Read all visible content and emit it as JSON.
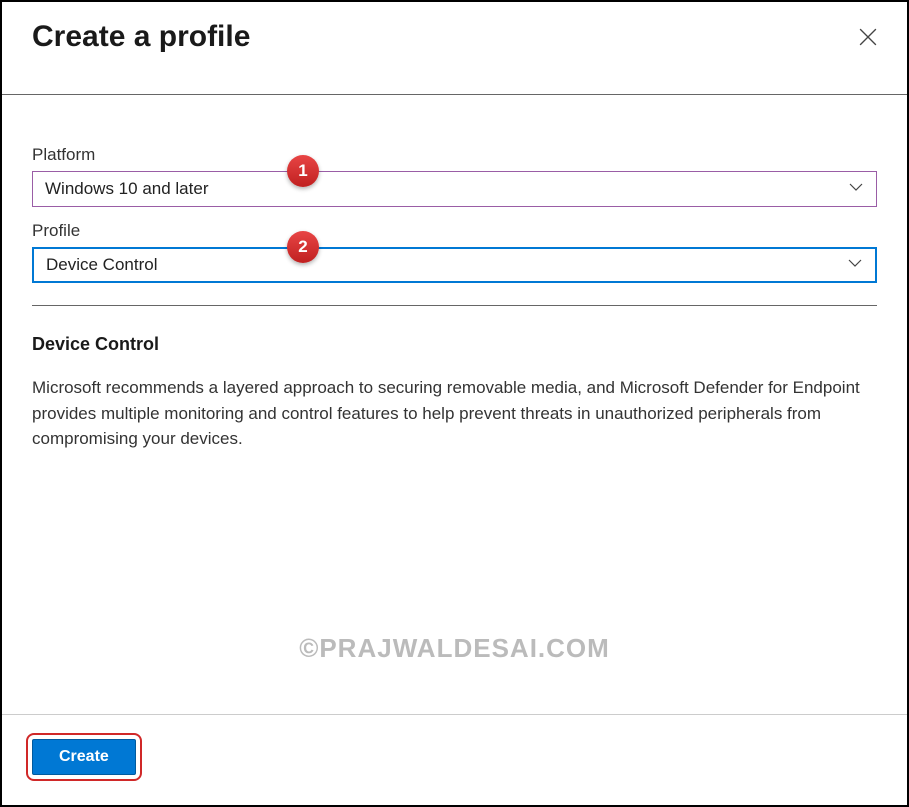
{
  "header": {
    "title": "Create a profile"
  },
  "fields": {
    "platform": {
      "label": "Platform",
      "value": "Windows 10 and later",
      "badge": "1"
    },
    "profile": {
      "label": "Profile",
      "value": "Device Control",
      "badge": "2"
    }
  },
  "section": {
    "title": "Device Control",
    "description": "Microsoft recommends a layered approach to securing removable media, and Microsoft Defender for Endpoint provides multiple monitoring and control features to help prevent threats in unauthorized peripherals from compromising your devices."
  },
  "watermark": "©PRAJWALDESAI.COM",
  "footer": {
    "create_label": "Create"
  }
}
